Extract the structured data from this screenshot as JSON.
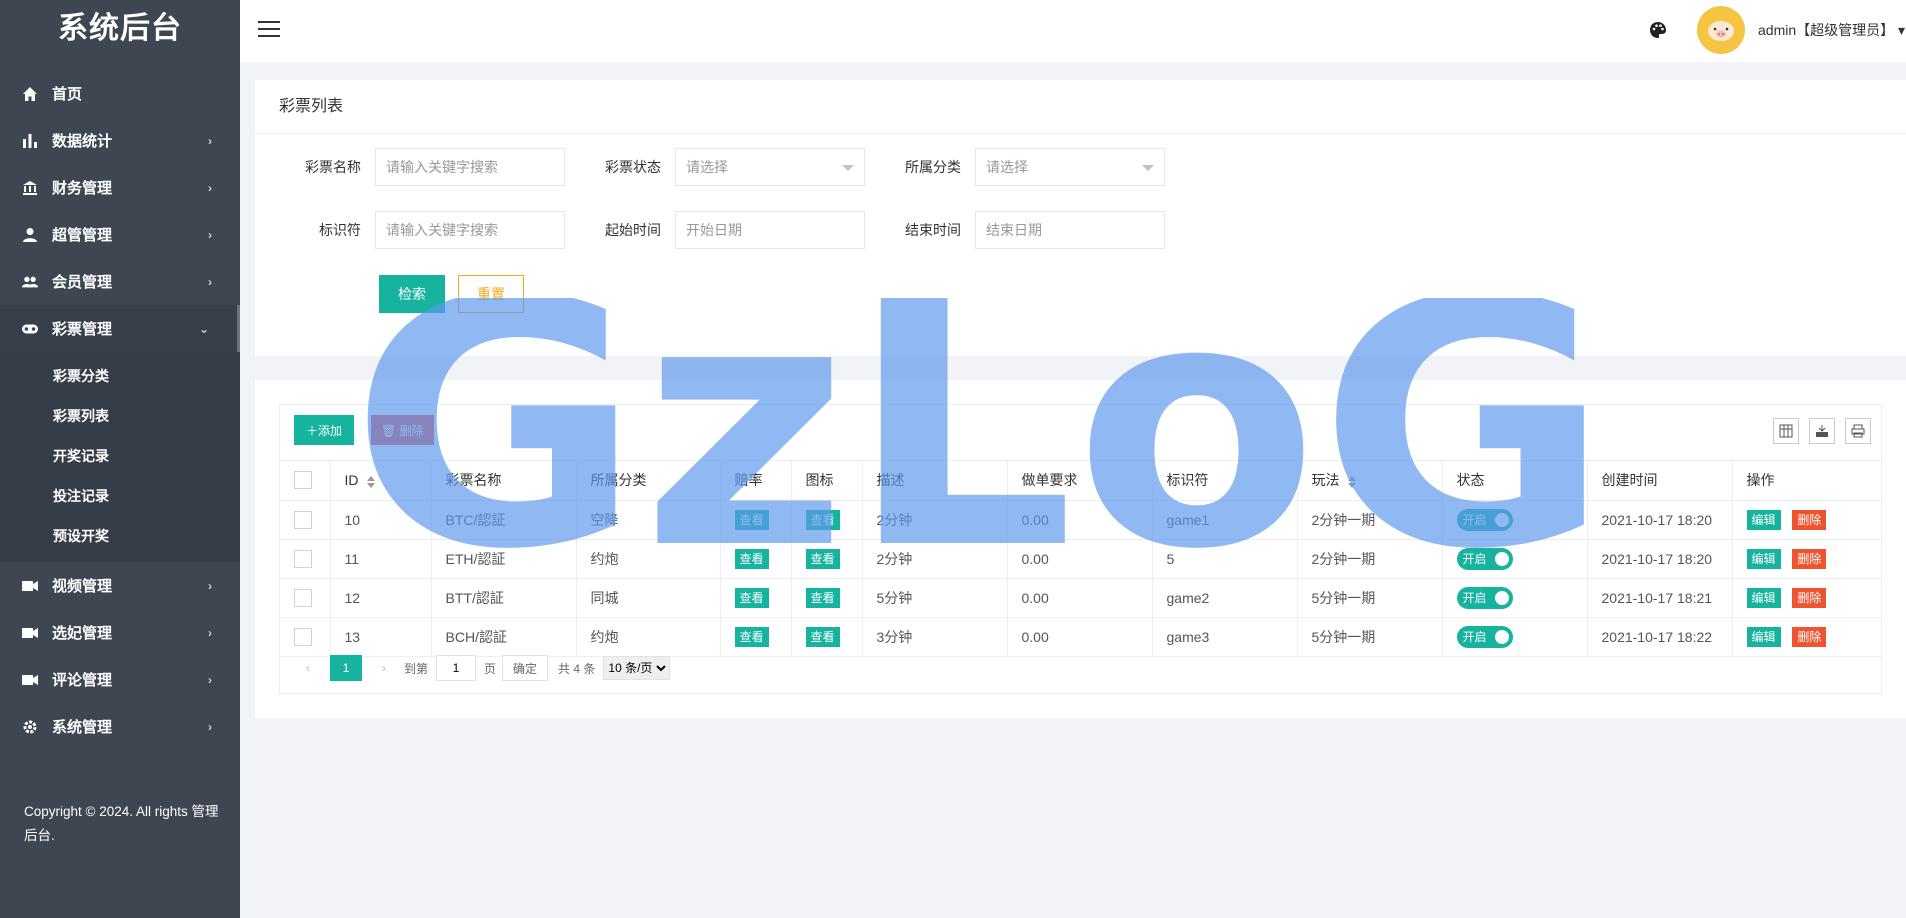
{
  "app": {
    "title": "系统后台",
    "copyright": "Copyright © 2024. All rights 管理后台."
  },
  "sidebar": {
    "items": [
      {
        "label": "首页",
        "icon": "home-icon"
      },
      {
        "label": "数据统计",
        "icon": "bar-chart-icon"
      },
      {
        "label": "财务管理",
        "icon": "bank-icon"
      },
      {
        "label": "超管管理",
        "icon": "user-icon"
      },
      {
        "label": "会员管理",
        "icon": "users-icon"
      },
      {
        "label": "彩票管理",
        "icon": "gamepad-icon"
      }
    ],
    "submenu": [
      "彩票分类",
      "彩票列表",
      "开奖记录",
      "投注记录",
      "预设开奖"
    ],
    "items_after": [
      {
        "label": "视频管理",
        "icon": "video-icon"
      },
      {
        "label": "选妃管理",
        "icon": "video-icon"
      },
      {
        "label": "评论管理",
        "icon": "video-icon"
      },
      {
        "label": "系统管理",
        "icon": "gear-icon"
      }
    ]
  },
  "header": {
    "user": "admin【超级管理员】"
  },
  "filter": {
    "title": "彩票列表",
    "name_label": "彩票名称",
    "name_placeholder": "请输入关键字搜索",
    "status_label": "彩票状态",
    "status_value": "请选择",
    "category_label": "所属分类",
    "category_value": "请选择",
    "ident_label": "标识符",
    "ident_placeholder": "请输入关键字搜索",
    "start_label": "起始时间",
    "start_placeholder": "开始日期",
    "end_label": "结束时间",
    "end_placeholder": "结束日期",
    "search_btn": "检索",
    "reset_btn": "重置"
  },
  "table": {
    "add_btn": "添加",
    "delete_btn": "删除",
    "headers": [
      "ID",
      "彩票名称",
      "所属分类",
      "赔率",
      "图标",
      "描述",
      "做单要求",
      "标识符",
      "玩法",
      "状态",
      "创建时间",
      "操作"
    ],
    "view_label": "查看",
    "edit_label": "编辑",
    "del_label": "删除",
    "on_label": "开启",
    "rows": [
      {
        "id": "10",
        "name": "BTC/認証",
        "category": "空降",
        "desc": "2分钟",
        "req": "0.00",
        "ident": "game1",
        "play": "2分钟一期",
        "created": "2021-10-17 18:20"
      },
      {
        "id": "11",
        "name": "ETH/認証",
        "category": "约炮",
        "desc": "2分钟",
        "req": "0.00",
        "ident": "5",
        "play": "2分钟一期",
        "created": "2021-10-17 18:20"
      },
      {
        "id": "12",
        "name": "BTT/認証",
        "category": "同城",
        "desc": "5分钟",
        "req": "0.00",
        "ident": "game2",
        "play": "5分钟一期",
        "created": "2021-10-17 18:21"
      },
      {
        "id": "13",
        "name": "BCH/認証",
        "category": "约炮",
        "desc": "3分钟",
        "req": "0.00",
        "ident": "game3",
        "play": "5分钟一期",
        "created": "2021-10-17 18:22"
      }
    ]
  },
  "pager": {
    "current": "1",
    "goto_label": "到第",
    "page_value": "1",
    "page_unit": "页",
    "confirm": "确定",
    "total": "共 4 条",
    "size": "10 条/页"
  },
  "watermark": {
    "text": "GzLoG",
    "color": "#5b97ec"
  },
  "colors": {
    "sidebar": "#3e4652",
    "accent": "#16b39e",
    "danger": "#ef5430",
    "warning": "#f7a91b"
  }
}
